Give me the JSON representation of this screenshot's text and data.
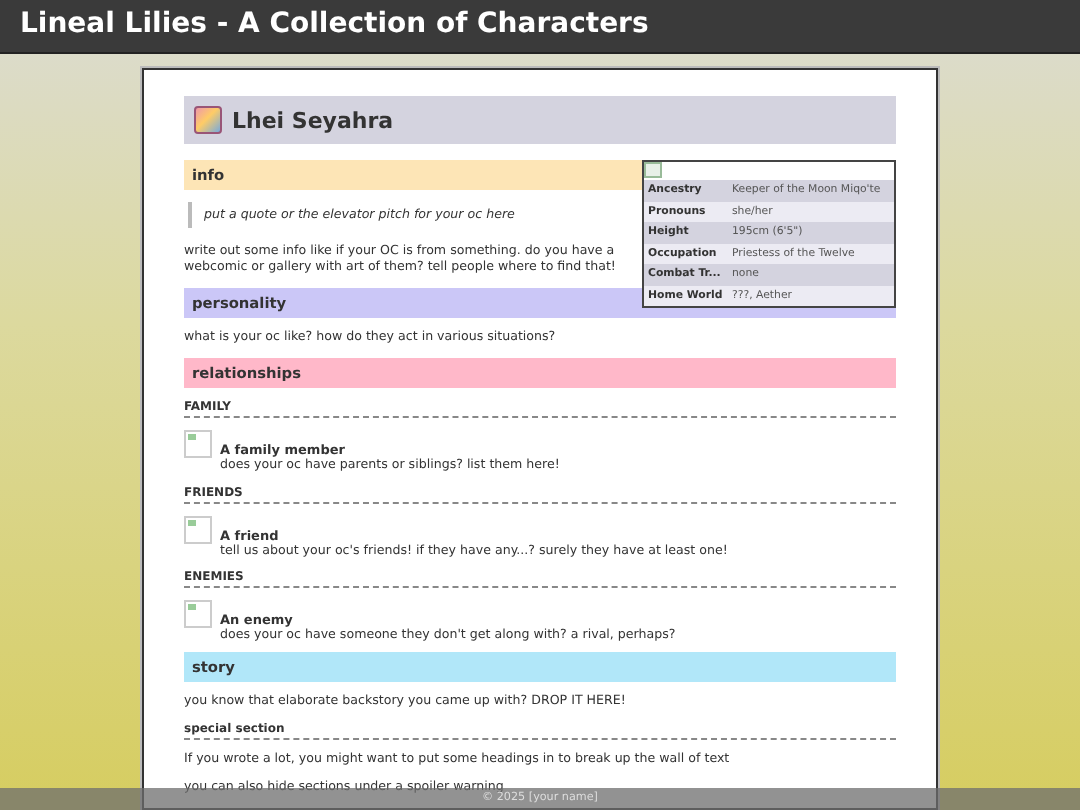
{
  "site_title": "Lineal Lilies - A Collection of Characters",
  "character": {
    "name": "Lhei Seyahra"
  },
  "infobox": {
    "rows": [
      {
        "label": "Ancestry",
        "value": "Keeper of the Moon Miqo'te"
      },
      {
        "label": "Pronouns",
        "value": "she/her"
      },
      {
        "label": "Height",
        "value": "195cm (6'5\")"
      },
      {
        "label": "Occupation",
        "value": "Priestess of the Twelve"
      },
      {
        "label": "Combat Tr...",
        "value": "none"
      },
      {
        "label": "Home World",
        "value": "???, Aether"
      }
    ]
  },
  "sections": [
    {
      "kind": "heading",
      "title": "info",
      "color": "#fde5b6"
    },
    {
      "kind": "quote",
      "text": "put a quote or the elevator pitch for your oc here"
    },
    {
      "kind": "paragraph",
      "text": "write out some info like if your OC is from something. do you have a webcomic or gallery with art of them? tell people where to find that!"
    },
    {
      "kind": "heading",
      "title": "personality",
      "color": "#cbc7f7"
    },
    {
      "kind": "paragraph",
      "text": "what is your oc like? how do they act in various situations?"
    },
    {
      "kind": "heading",
      "title": "relationships",
      "color": "#ffb8c9"
    },
    {
      "kind": "subheading",
      "title": "FAMILY"
    },
    {
      "kind": "member",
      "name": "A family member",
      "description": "does your oc have parents or siblings? list them here!"
    },
    {
      "kind": "subheading",
      "title": "FRIENDS"
    },
    {
      "kind": "member",
      "name": "A friend",
      "description": "tell us about your oc's friends! if they have any...? surely they have at least one!"
    },
    {
      "kind": "subheading",
      "title": "ENEMIES"
    },
    {
      "kind": "member",
      "name": "An enemy",
      "description": "does your oc have someone they don't get along with? a rival, perhaps?"
    },
    {
      "kind": "heading",
      "title": "story",
      "color": "#b1e7f9"
    },
    {
      "kind": "paragraph",
      "text": "you know that elaborate backstory you came up with? DROP IT HERE!"
    },
    {
      "kind": "subheading",
      "title": "special section"
    },
    {
      "kind": "paragraph",
      "text": "If you wrote a lot, you might want to put some headings in to break up the wall of text"
    },
    {
      "kind": "paragraph",
      "text": "you can also hide sections under a spoiler warning"
    }
  ],
  "footer": "© 2025 [your name]"
}
